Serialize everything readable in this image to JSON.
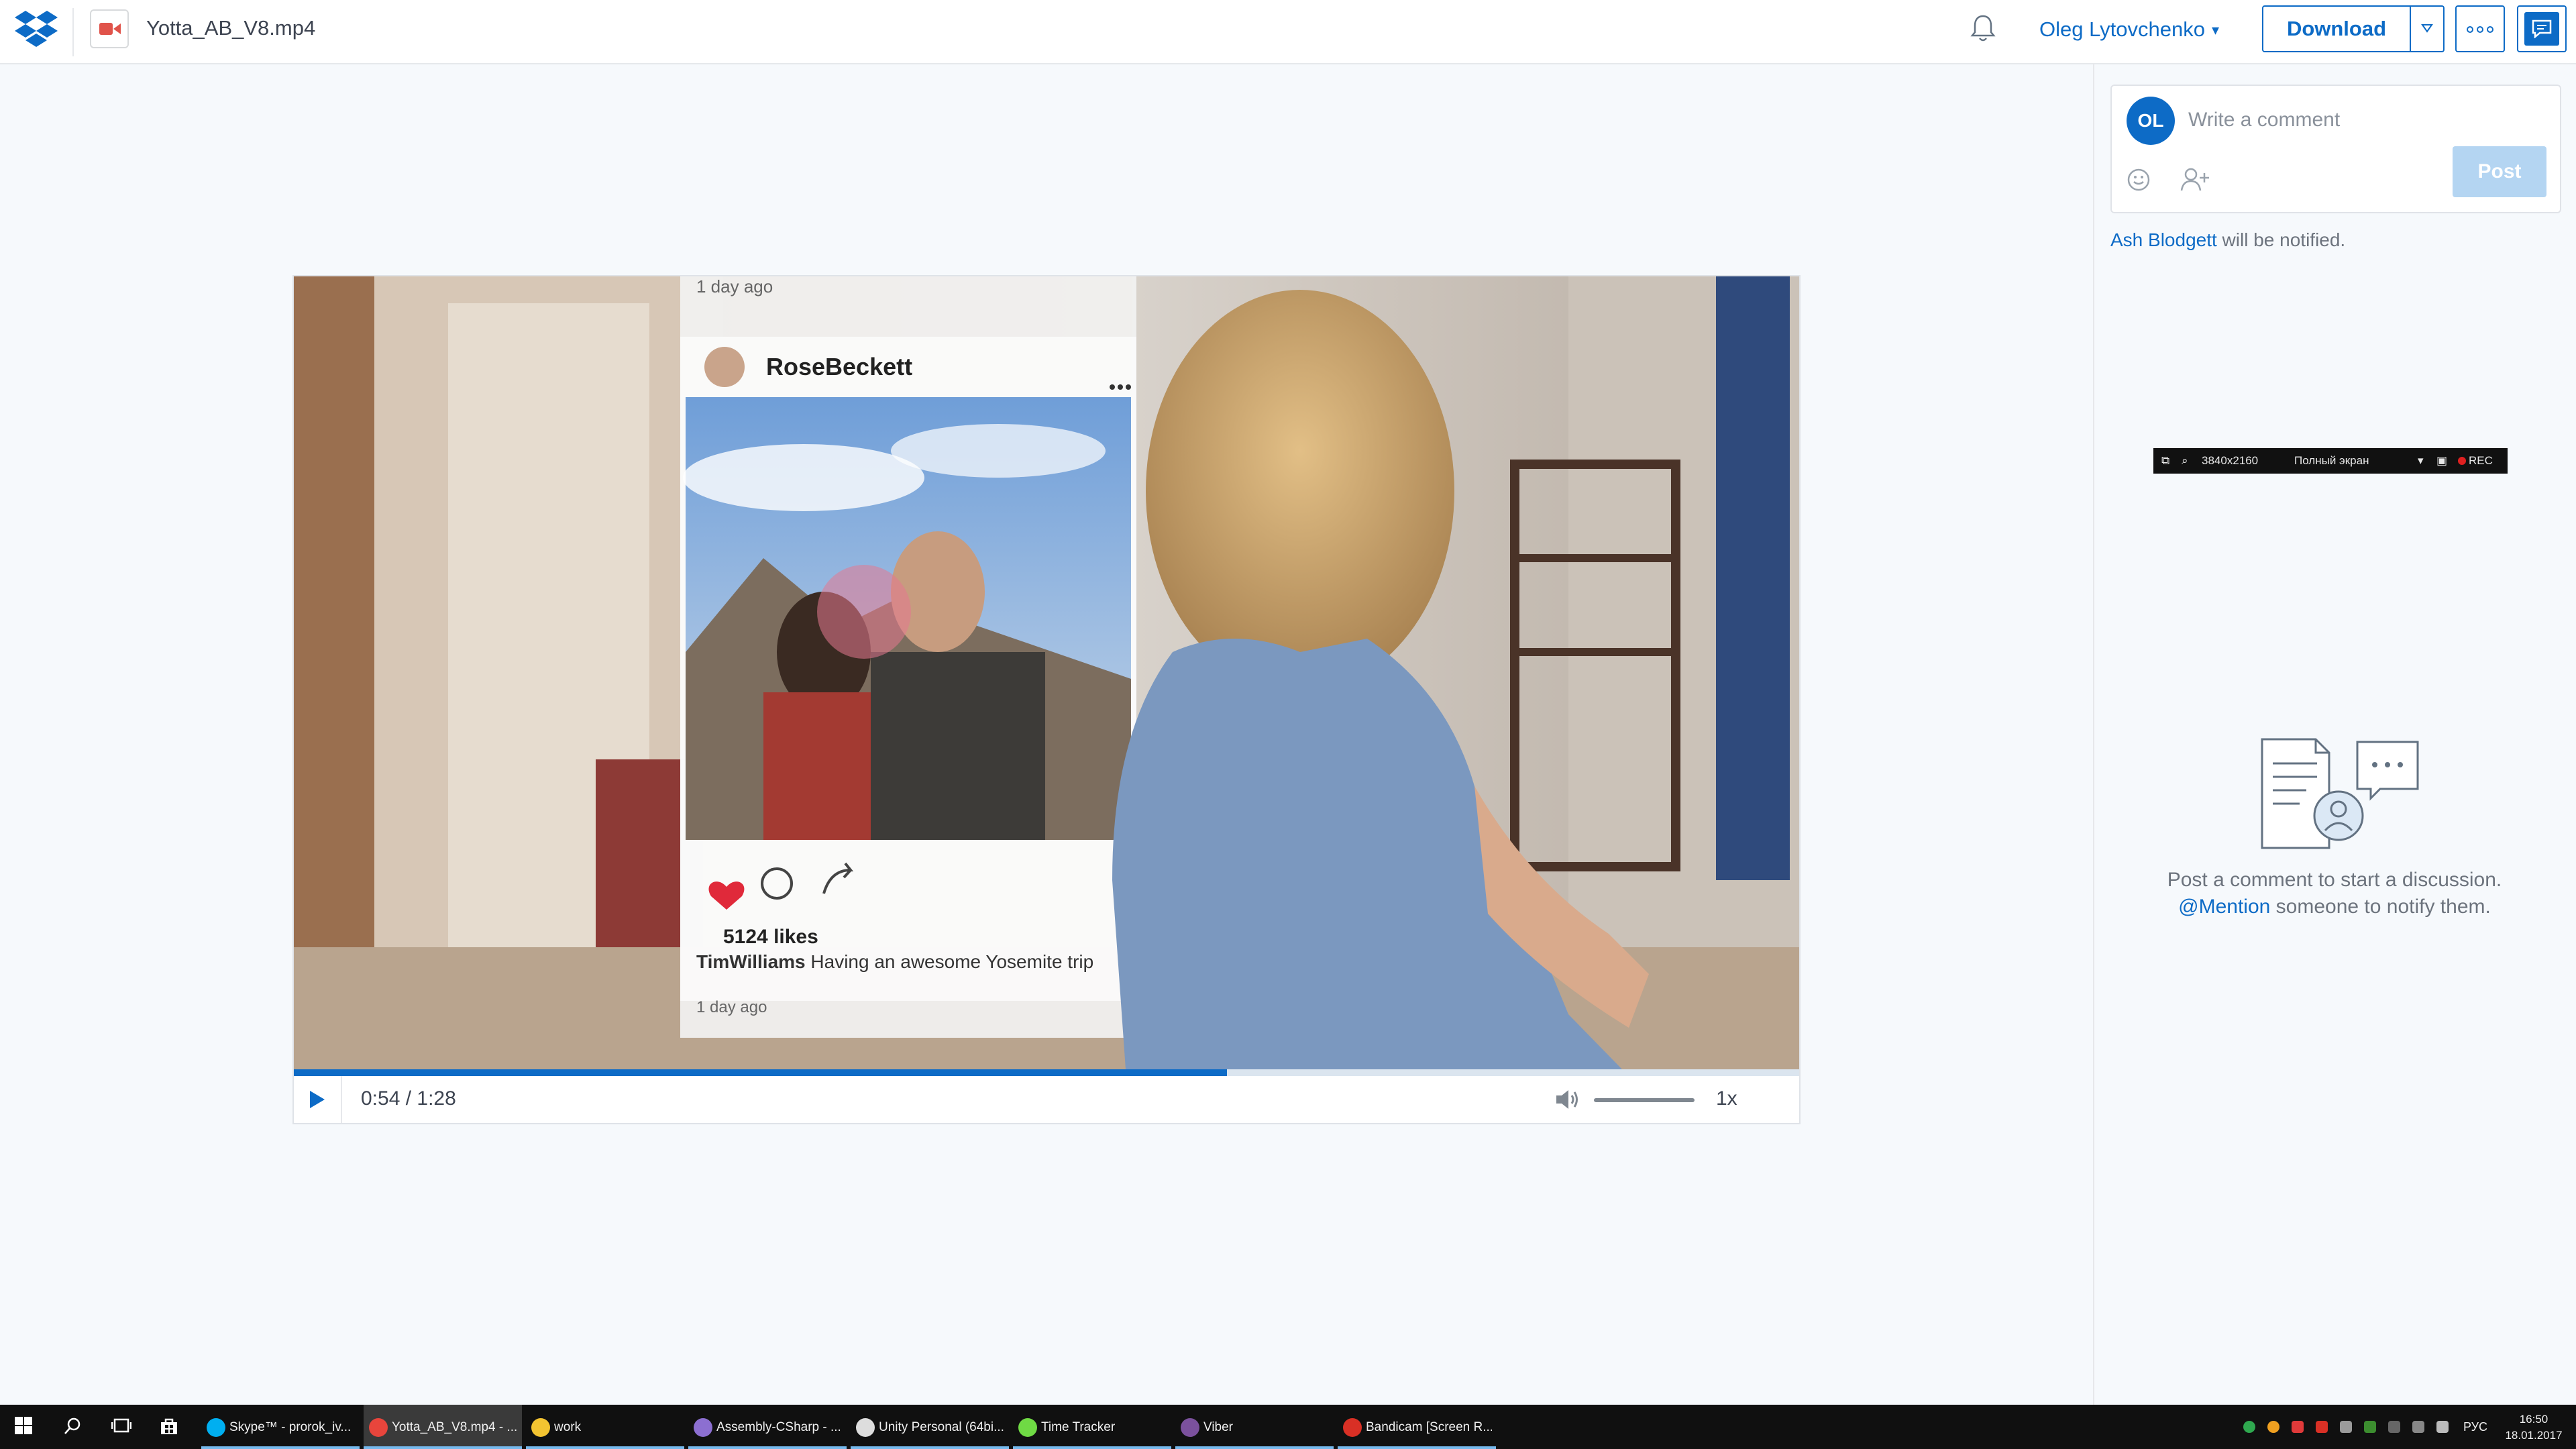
{
  "header": {
    "file_name": "Yotta_AB_V8.mp4",
    "user_name": "Oleg Lytovchenko",
    "download_label": "Download"
  },
  "video": {
    "time_display": "0:54 / 1:28",
    "current_time": "0:54",
    "duration": "1:28",
    "progress_fraction": 0.62,
    "speed_label": "1x",
    "overlay_post": {
      "username": "RoseBeckett",
      "top_timestamp": "1 day ago",
      "likes": "5124 likes",
      "caption_user": "TimWilliams",
      "caption_text": "Having an awesome Yosemite trip",
      "bottom_timestamp": "1 day ago",
      "menu": "..."
    }
  },
  "comments": {
    "avatar_initials": "OL",
    "input_placeholder": "Write a comment",
    "post_label": "Post",
    "notify_name": "Ash Blodgett",
    "notify_text": " will be notified.",
    "empty_line1": "Post a comment to start a discussion.",
    "empty_mention": "@Mention",
    "empty_line2_rest": " someone to notify them."
  },
  "recorder_bar": {
    "resolution": "3840x2160",
    "mode": "Полный экран",
    "rec_label": "REC"
  },
  "taskbar": {
    "apps": [
      {
        "label": "Skype™ - prorok_iv...",
        "icon_color": "#00aff0",
        "active": false
      },
      {
        "label": "Yotta_AB_V8.mp4 - ...",
        "icon_color": "#e8453c",
        "active": true
      },
      {
        "label": "work",
        "icon_color": "#f3c431",
        "active": false
      },
      {
        "label": "Assembly-CSharp - ...",
        "icon_color": "#8c6fd1",
        "active": false
      },
      {
        "label": "Unity Personal (64bi...",
        "icon_color": "#dddddd",
        "active": false
      },
      {
        "label": "Time Tracker",
        "icon_color": "#6fda44",
        "active": false
      },
      {
        "label": "Viber",
        "icon_color": "#7b519d",
        "active": false
      },
      {
        "label": "Bandicam [Screen R...",
        "icon_color": "#d93025",
        "active": false
      }
    ],
    "language": "РУС",
    "time": "16:50",
    "date": "18.01.2017"
  },
  "colors": {
    "accent": "#0d6bc6",
    "background": "#f6f9fc",
    "post_disabled": "#b4d5f2"
  }
}
